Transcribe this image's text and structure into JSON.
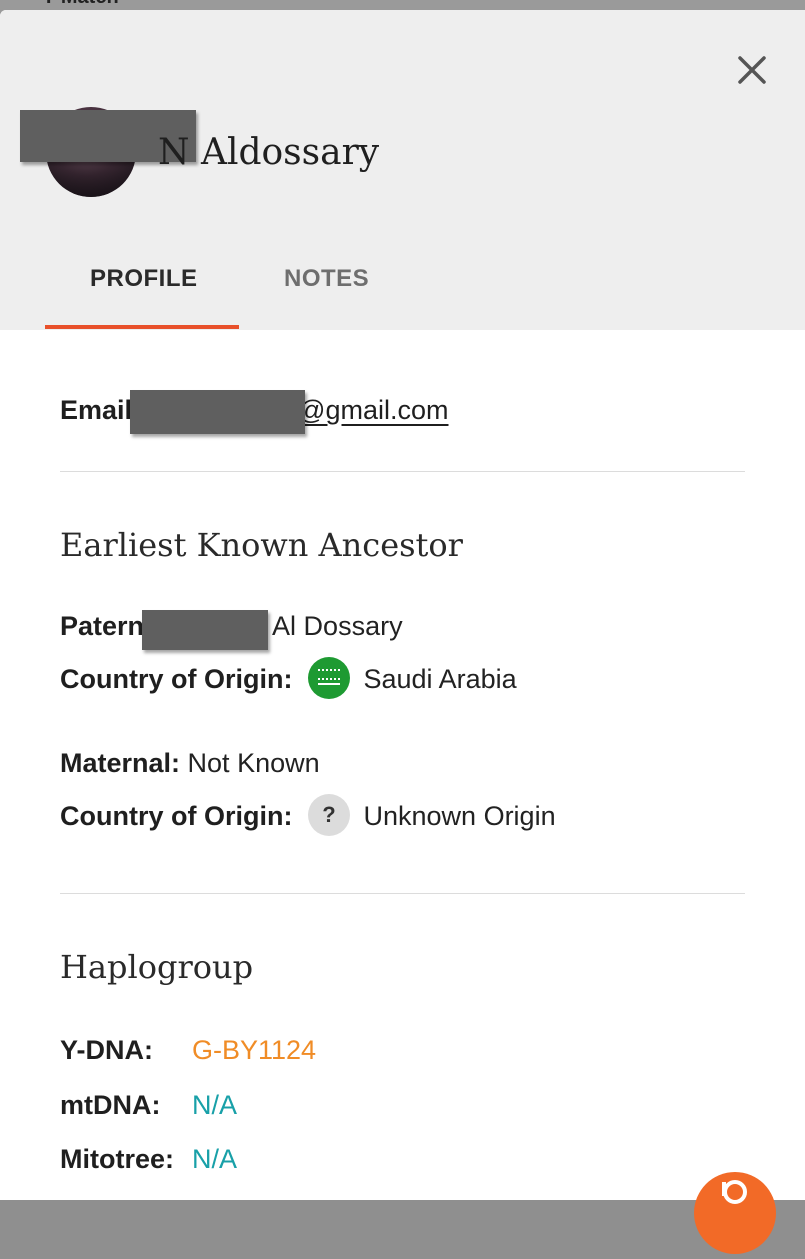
{
  "backdrop": {
    "partial_text": "Y-Match"
  },
  "header": {
    "name": "N Aldossary",
    "tabs": [
      {
        "label": "PROFILE",
        "active": true
      },
      {
        "label": "NOTES",
        "active": false
      }
    ]
  },
  "email": {
    "label": "Email",
    "value_visible": "@gmail.com"
  },
  "ancestor": {
    "title": "Earliest Known Ancestor",
    "paternal_label_visible": "Patern",
    "paternal_value": "Al Dossary",
    "paternal_country_label": "Country of Origin:",
    "paternal_country": "Saudi Arabia",
    "maternal_label": "Maternal:",
    "maternal_value": "Not Known",
    "maternal_country_label": "Country of Origin:",
    "maternal_country_icon_text": "?",
    "maternal_country": "Unknown Origin"
  },
  "haplogroup": {
    "title": "Haplogroup",
    "ydna_label": "Y-DNA:",
    "ydna_value": "G-BY1124",
    "mtdna_label": "mtDNA:",
    "mtdna_value": "N/A",
    "mitotree_label": "Mitotree:",
    "mitotree_value": "N/A"
  },
  "colors": {
    "accent": "#e8502a",
    "ydna": "#f08c26",
    "teal": "#18a0a8",
    "flag_green": "#1e9a32"
  },
  "icons": [
    "close-icon",
    "saudi-flag-icon",
    "question-icon",
    "chat-fab-icon"
  ]
}
